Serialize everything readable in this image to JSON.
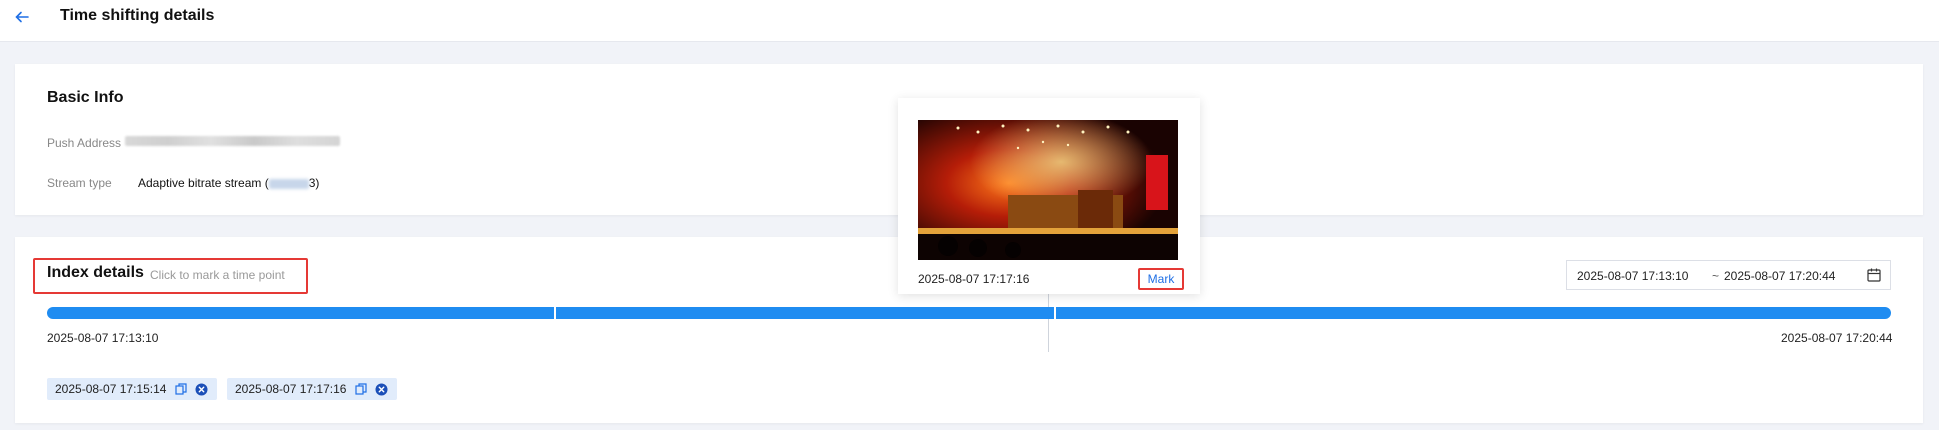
{
  "header": {
    "back_icon": "arrow-left-icon",
    "title": "Time shifting details"
  },
  "basic_info": {
    "title": "Basic Info",
    "push_address_label": "Push Address",
    "stream_type_label": "Stream type",
    "stream_type_value_prefix": "Adaptive bitrate stream (",
    "stream_type_value_suffix": "3)"
  },
  "index_details": {
    "title": "Index details",
    "hint": "Click to mark a time point",
    "date_range": {
      "start": "2025-08-07 17:13:10",
      "separator": "~",
      "end": "2025-08-07 17:20:44",
      "icon": "calendar-icon"
    },
    "timeline": {
      "start_label": "2025-08-07 17:13:10",
      "end_label": "2025-08-07 17:20:44",
      "marker_positions": [
        0.275,
        0.546
      ],
      "cursor_position": 0.543
    },
    "tags": [
      {
        "label": "2025-08-07 17:15:14"
      },
      {
        "label": "2025-08-07 17:17:16"
      }
    ]
  },
  "popup": {
    "time": "2025-08-07 17:17:16",
    "mark_label": "Mark"
  },
  "colors": {
    "accent": "#1f8cf1",
    "highlight_border": "#e53935",
    "tag_bg": "#e1ecfb",
    "link": "#1f6fe5"
  }
}
